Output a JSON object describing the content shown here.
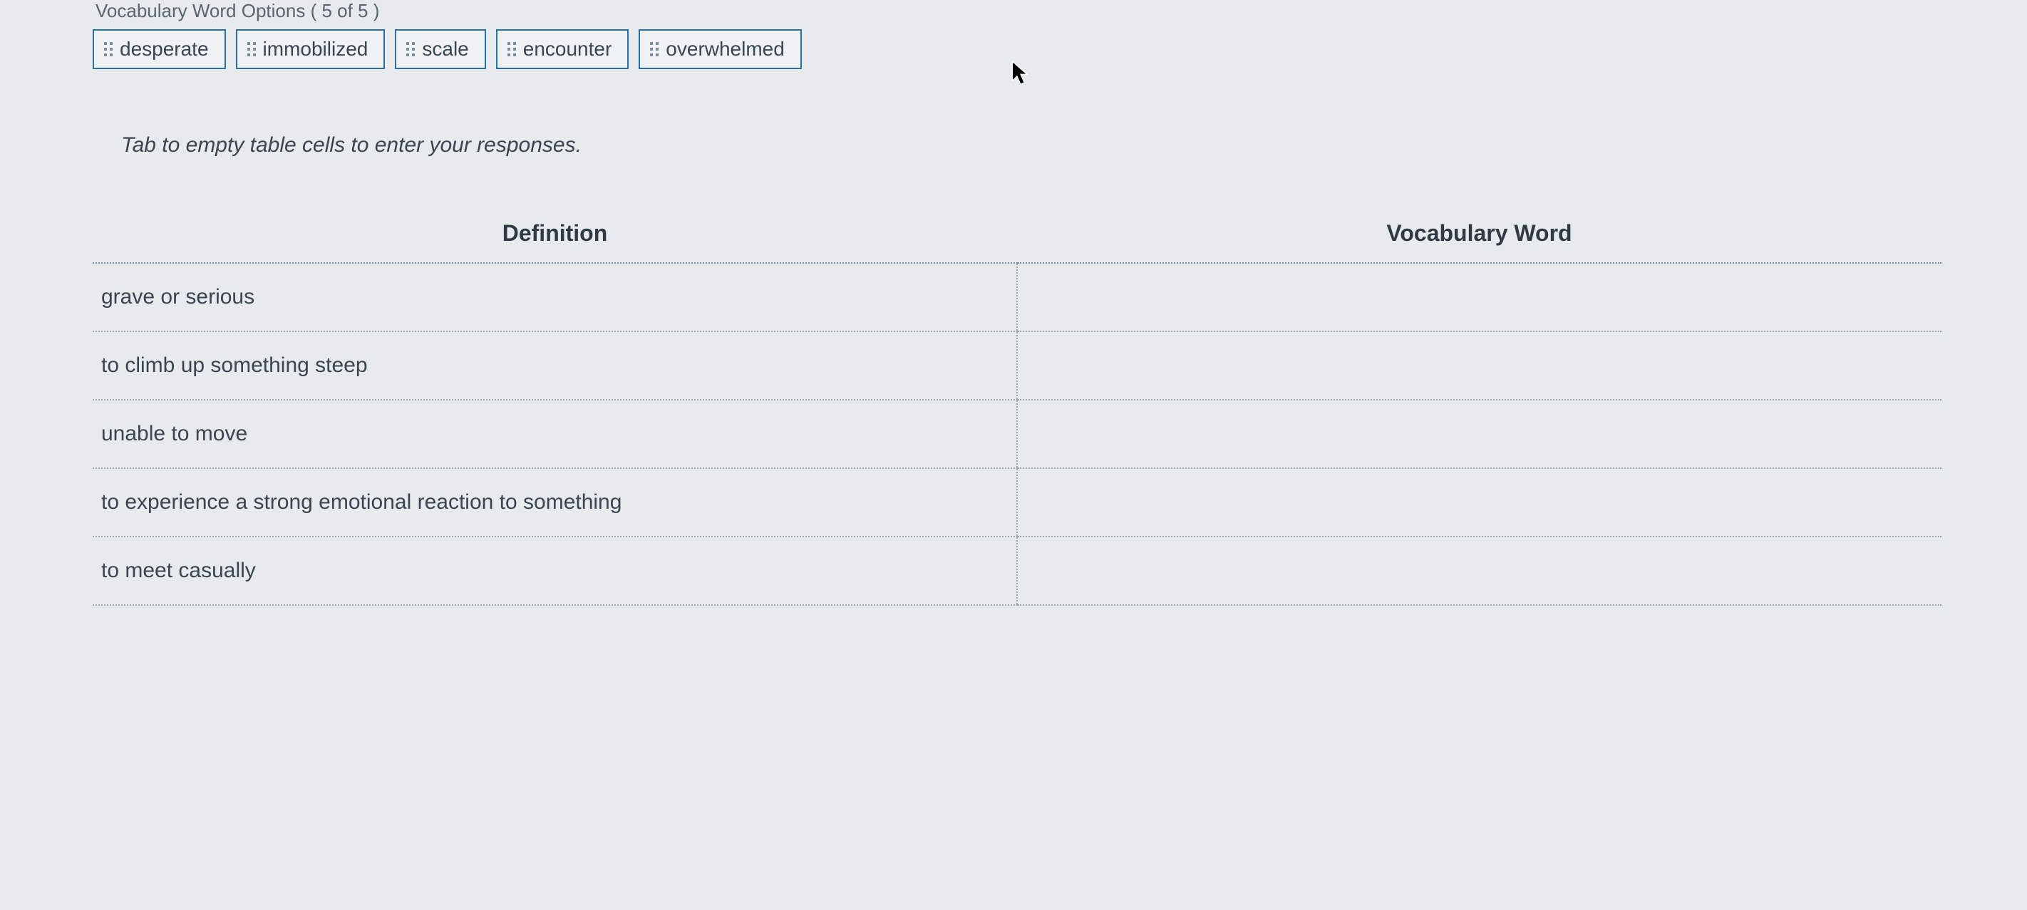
{
  "header": {
    "options_label": "Vocabulary Word Options ( 5 of 5 )"
  },
  "options": [
    "desperate",
    "immobilized",
    "scale",
    "encounter",
    "overwhelmed"
  ],
  "instructions": "Tab to empty table cells to enter your responses.",
  "table": {
    "headers": {
      "definition": "Definition",
      "word": "Vocabulary Word"
    },
    "rows": [
      {
        "definition": "grave or serious",
        "word": ""
      },
      {
        "definition": "to climb up something steep",
        "word": ""
      },
      {
        "definition": "unable to move",
        "word": ""
      },
      {
        "definition": "to experience a strong emotional reaction to something",
        "word": ""
      },
      {
        "definition": "to meet casually",
        "word": ""
      }
    ]
  }
}
